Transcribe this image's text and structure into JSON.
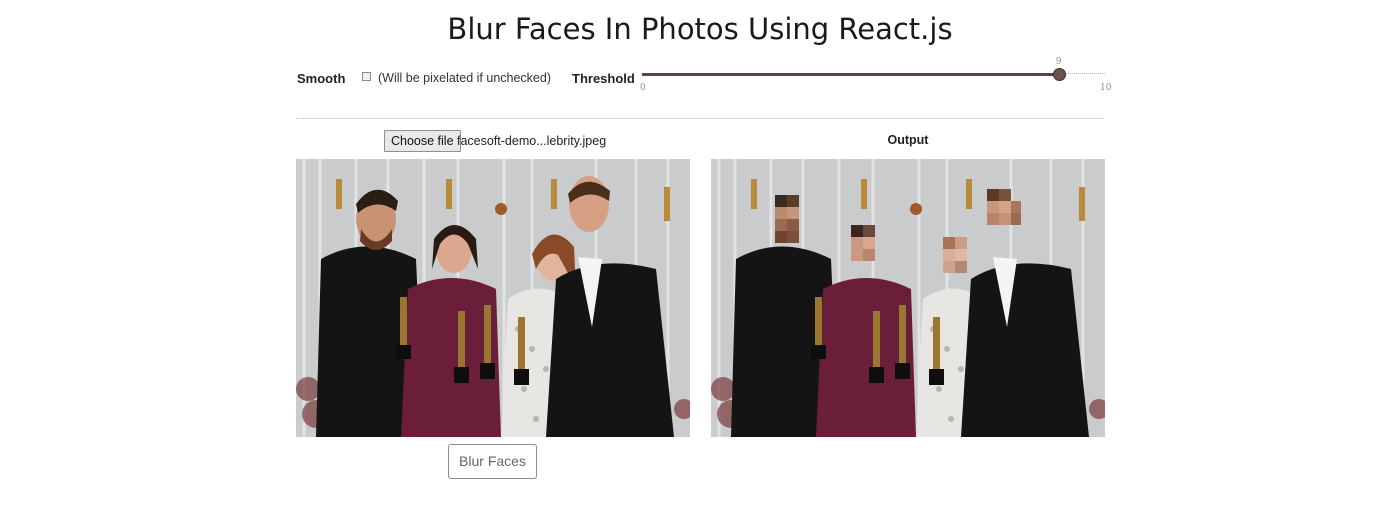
{
  "page": {
    "title": "Blur Faces In Photos Using React.js"
  },
  "controls": {
    "smooth_label": "Smooth",
    "smooth_checked": false,
    "smooth_hint": "(Will be pixelated if unchecked)",
    "threshold_label": "Threshold",
    "threshold": {
      "value": 9,
      "min": 0,
      "max": 10,
      "value_text": "9",
      "min_text": "0",
      "max_text": "10"
    }
  },
  "input": {
    "choose_file_label": "Choose file",
    "file_name": "facesoft-demo...lebrity.jpeg"
  },
  "output": {
    "label": "Output"
  },
  "actions": {
    "blur_button_label": "Blur Faces"
  },
  "colors": {
    "slider_fill": "#5a4542",
    "photo_bg": "#c9cbcd",
    "dress_maroon": "#6b1e3a",
    "suit_black": "#141414"
  }
}
